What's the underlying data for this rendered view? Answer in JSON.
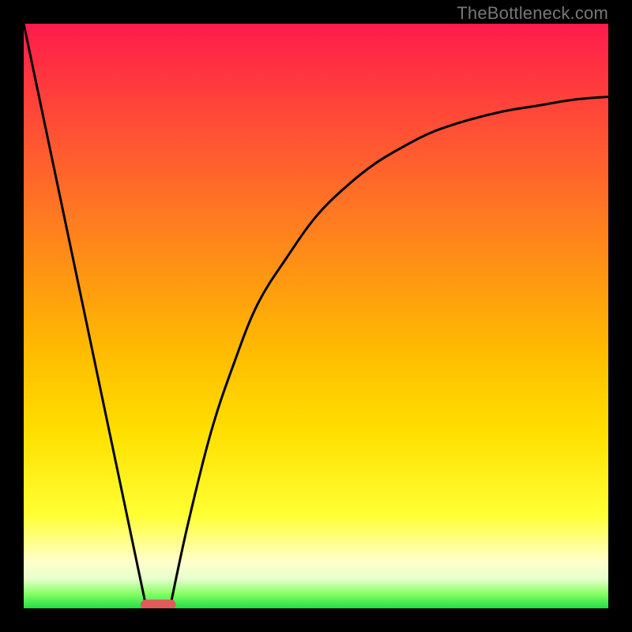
{
  "brand": "TheBottleneck.com",
  "chart_data": {
    "type": "line",
    "title": "",
    "xlabel": "",
    "ylabel": "",
    "xlim": [
      0,
      100
    ],
    "ylim": [
      0,
      100
    ],
    "grid": false,
    "legend": false,
    "annotations": [],
    "series": [
      {
        "name": "left-slope",
        "x": [
          0,
          21
        ],
        "y": [
          100,
          0
        ]
      },
      {
        "name": "right-curve",
        "x": [
          25,
          28,
          32,
          36,
          40,
          45,
          50,
          55,
          60,
          65,
          70,
          76,
          82,
          88,
          94,
          100
        ],
        "y": [
          0,
          14,
          30,
          42,
          52,
          60,
          67,
          72,
          76,
          79,
          81.5,
          83.5,
          85,
          86,
          87,
          87.5
        ]
      }
    ],
    "marker": {
      "name": "min-marker",
      "x_center": 23,
      "x_halfwidth": 3,
      "color": "#e05a5a"
    },
    "gradient_colors": {
      "top": "#ff1a4d",
      "mid": "#ffe000",
      "bottom": "#22dd44"
    },
    "frame_color": "#000000"
  }
}
